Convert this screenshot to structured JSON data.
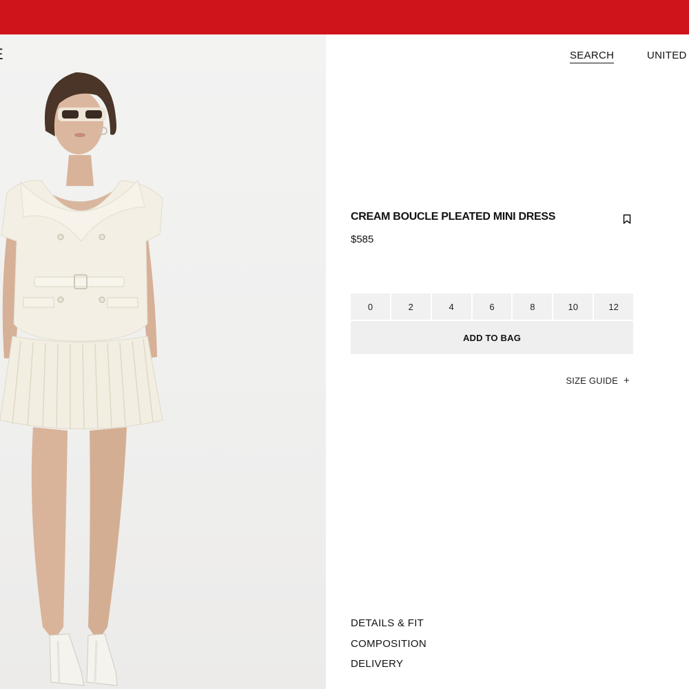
{
  "header": {
    "logo_fragment": "E",
    "search_label": "SEARCH",
    "region_label": "UNITED S",
    "banner_color": "#d0141b"
  },
  "product": {
    "title": "CREAM BOUCLE PLEATED MINI DRESS",
    "price": "$585",
    "bookmark_icon": "bookmark-icon",
    "sizes": [
      "0",
      "2",
      "4",
      "6",
      "8",
      "10",
      "12"
    ],
    "add_to_bag_label": "ADD TO BAG",
    "size_guide_label": "SIZE GUIDE",
    "size_guide_icon": "+"
  },
  "info_sections": [
    "DETAILS & FIT",
    "COMPOSITION",
    "DELIVERY"
  ]
}
